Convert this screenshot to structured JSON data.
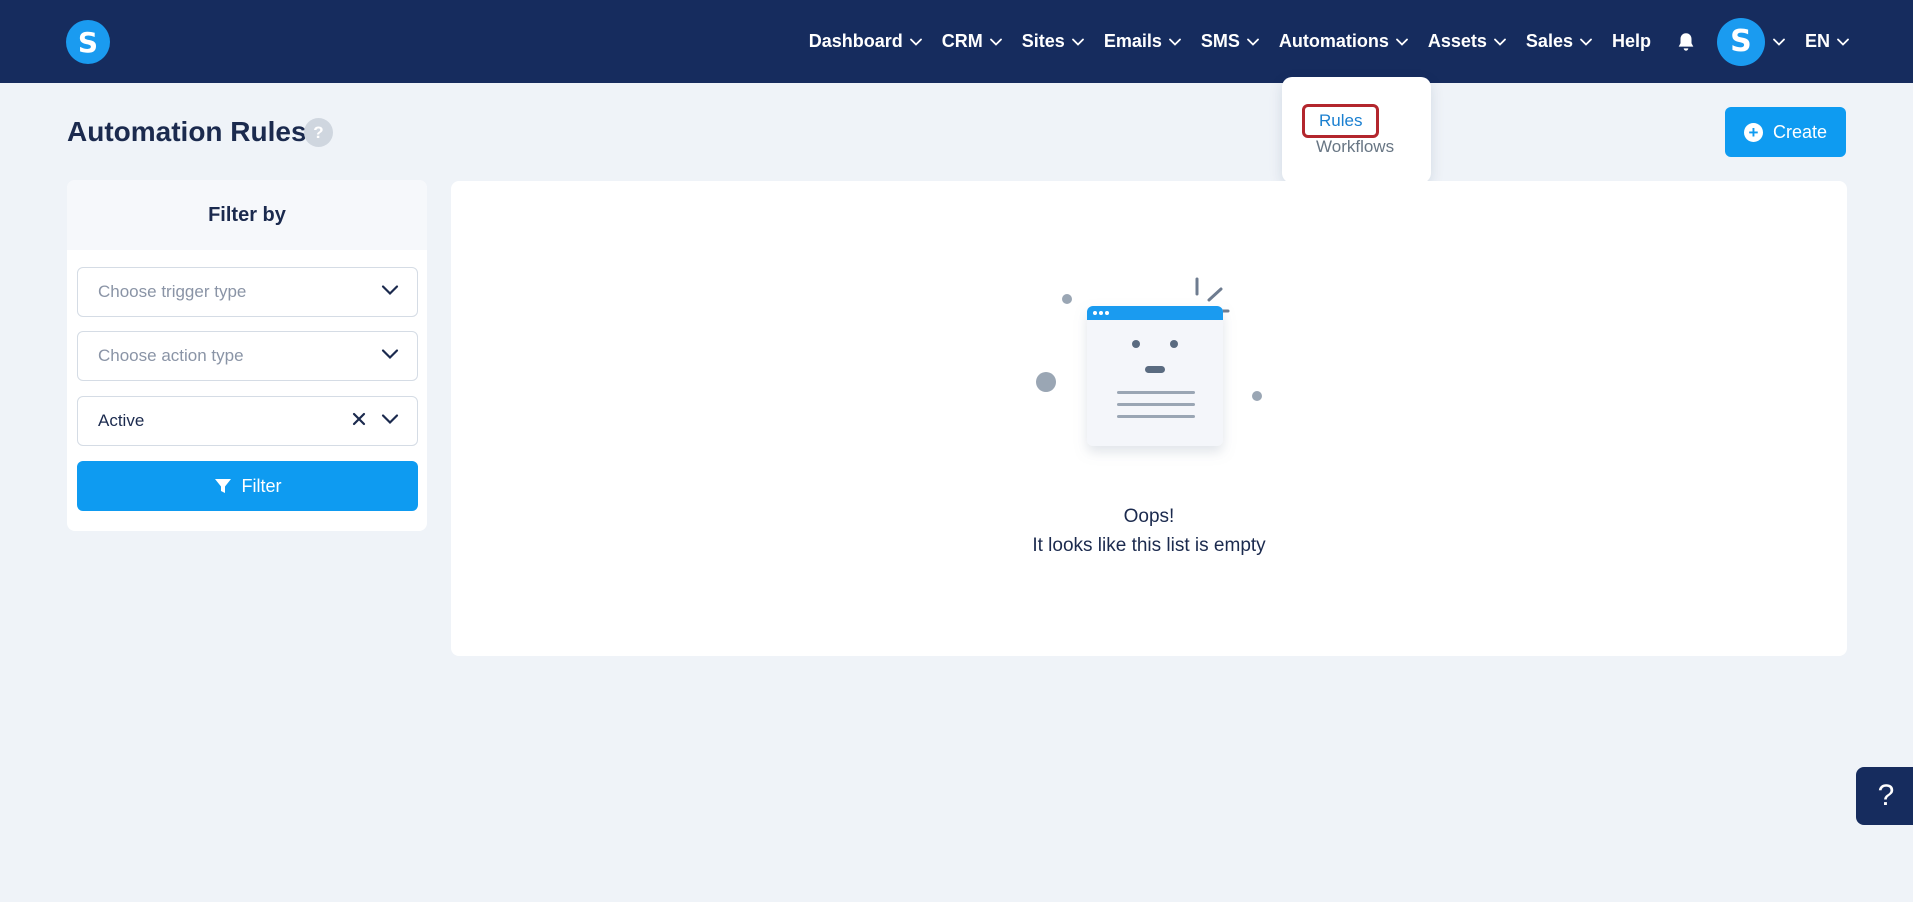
{
  "brand": {
    "logo_letter": "S"
  },
  "nav": {
    "items": [
      {
        "label": "Dashboard",
        "has_dropdown": true
      },
      {
        "label": "CRM",
        "has_dropdown": true
      },
      {
        "label": "Sites",
        "has_dropdown": true
      },
      {
        "label": "Emails",
        "has_dropdown": true
      },
      {
        "label": "SMS",
        "has_dropdown": true
      },
      {
        "label": "Automations",
        "has_dropdown": true
      },
      {
        "label": "Assets",
        "has_dropdown": true
      },
      {
        "label": "Sales",
        "has_dropdown": true
      },
      {
        "label": "Help",
        "has_dropdown": false
      }
    ],
    "avatar_letter": "S",
    "language": "EN"
  },
  "automations_dropdown": {
    "items": [
      {
        "label": "Rules",
        "highlighted": true
      },
      {
        "label": "Workflows",
        "highlighted": false
      }
    ]
  },
  "header": {
    "title": "Automation Rules",
    "help_badge": "?",
    "create_label": "Create"
  },
  "filter": {
    "title": "Filter by",
    "trigger_placeholder": "Choose trigger type",
    "action_placeholder": "Choose action type",
    "status_value": "Active",
    "button_label": "Filter"
  },
  "empty_state": {
    "line1": "Oops!",
    "line2": "It looks like this list is empty"
  },
  "help_fab": {
    "label": "?"
  },
  "colors": {
    "navbar": "#162c5e",
    "primary": "#0e9bf1",
    "background": "#eff3f8",
    "highlight_border": "#b3262d"
  }
}
